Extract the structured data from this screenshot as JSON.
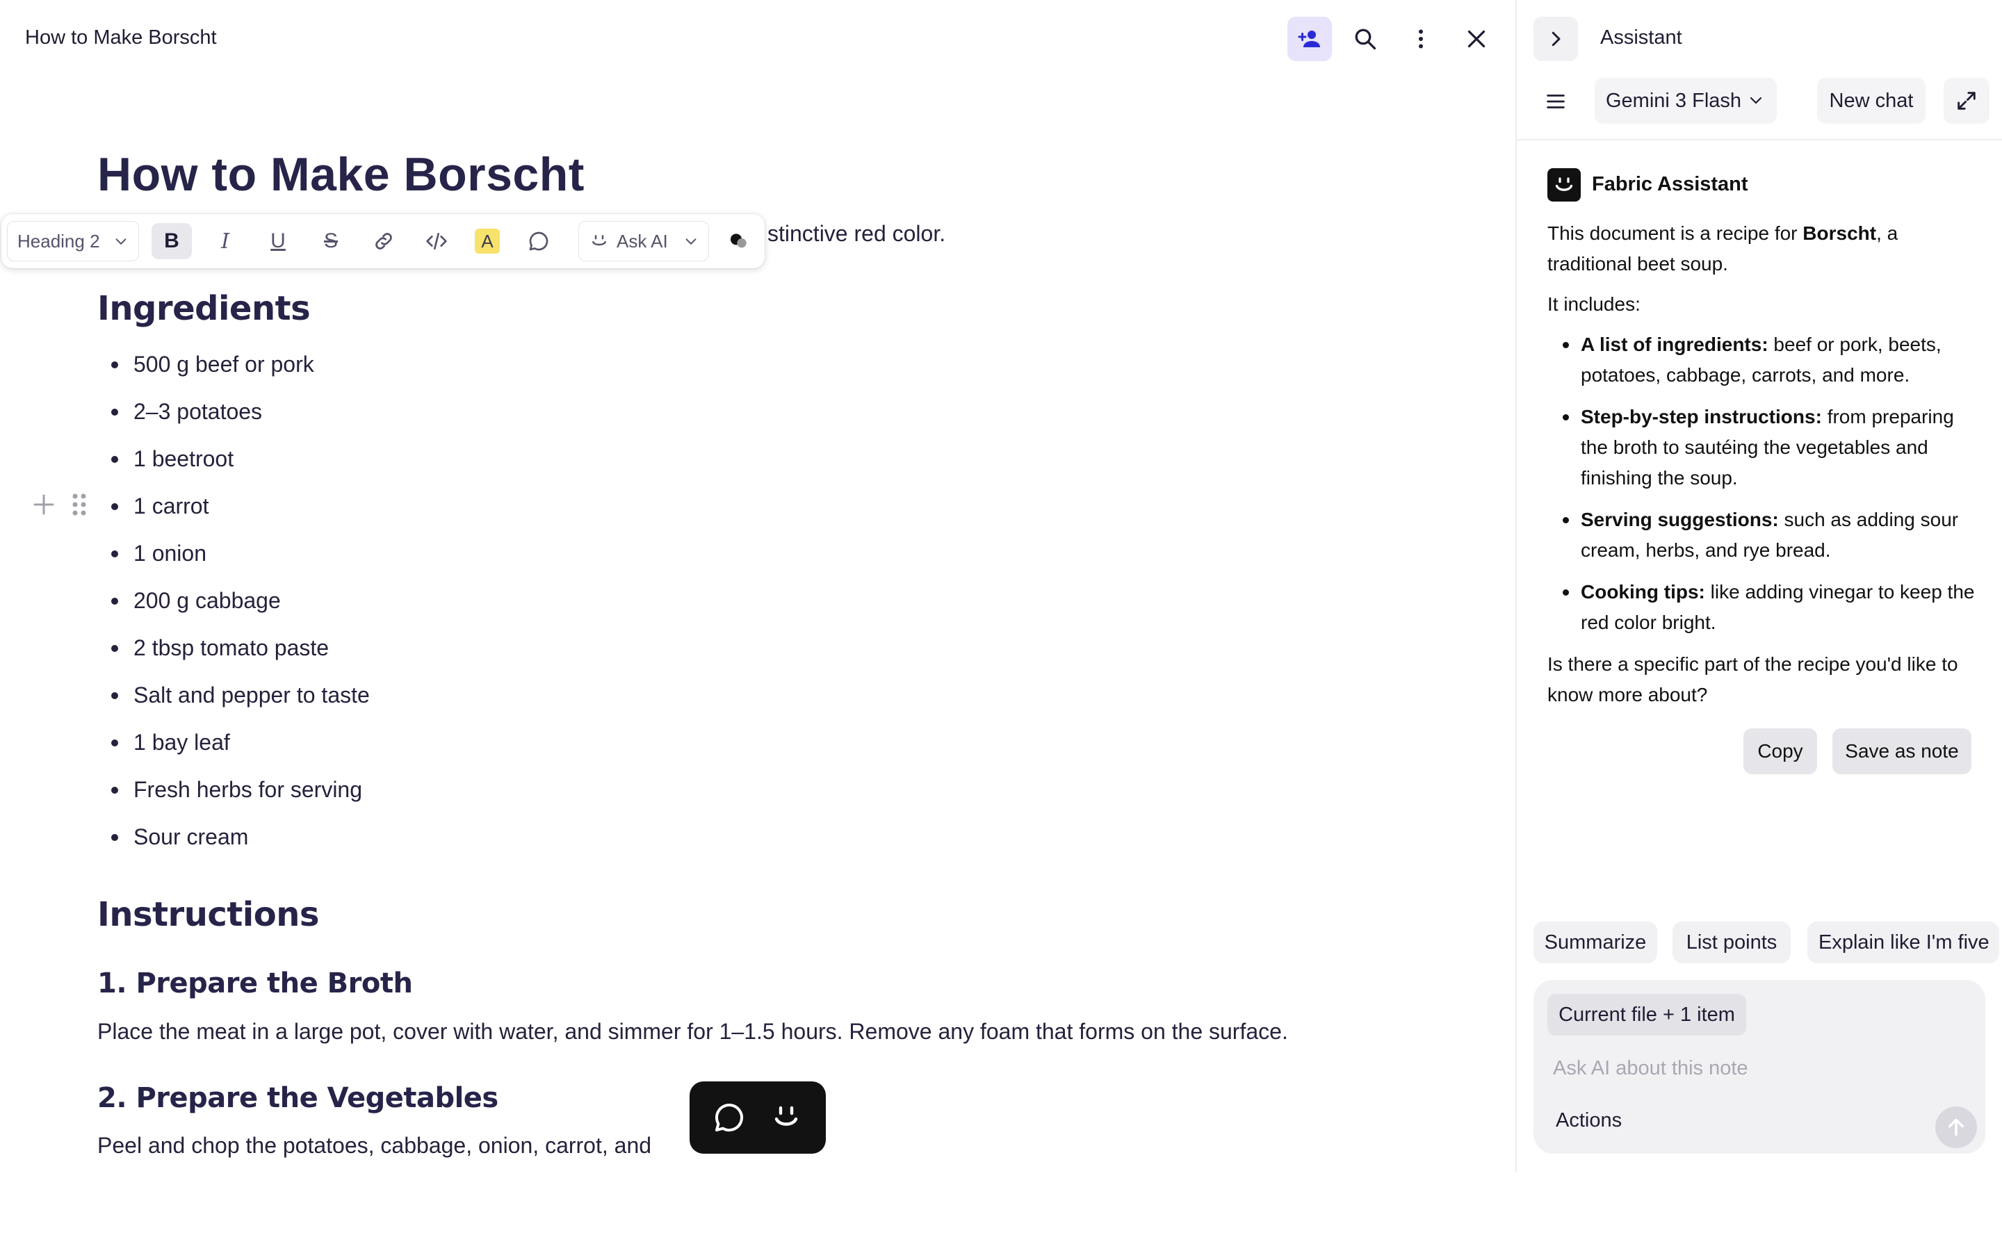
{
  "doc": {
    "topbar_title": "How to Make Borscht",
    "title": "How to Make Borscht",
    "intro_visible_tail": "stinctive red color.",
    "toolbar": {
      "block_type": "Heading 2",
      "bold": "B",
      "italic": "I",
      "underline": "U",
      "strike": "S",
      "highlight": "A",
      "ask_ai": "Ask AI"
    },
    "ingredients_heading": "Ingredients",
    "ingredients": [
      "500 g beef or pork",
      "2–3 potatoes",
      "1 beetroot",
      "1 carrot",
      "1 onion",
      "200 g cabbage",
      "2 tbsp tomato paste",
      "Salt and pepper to taste",
      "1 bay leaf",
      "Fresh herbs for serving",
      "Sour cream"
    ],
    "instructions_heading": "Instructions",
    "step1_heading": "1. Prepare the Broth",
    "step1_text": "Place the meat in a large pot, cover with water, and simmer for 1–1.5 hours. Remove any foam that forms on the surface.",
    "step2_heading": "2. Prepare the Vegetables",
    "step2_text": "Peel and chop the potatoes, cabbage, onion, carrot, and"
  },
  "assistant": {
    "title": "Assistant",
    "model": "Gemini 3 Flash",
    "new_chat": "New chat",
    "bot_name": "Fabric Assistant",
    "answer": {
      "intro_before": "This document is a recipe for ",
      "intro_bold": "Borscht",
      "intro_after": ", a traditional beet soup.",
      "includes": "It includes:",
      "items": [
        {
          "bold": "A list of ingredients:",
          "text": " beef or pork, beets, potatoes, cabbage, carrots, and more."
        },
        {
          "bold": "Step-by-step instructions:",
          "text": " from preparing the broth to sautéing the vegetables and finishing the soup."
        },
        {
          "bold": "Serving suggestions:",
          "text": " such as adding sour cream, herbs, and rye bread."
        },
        {
          "bold": "Cooking tips:",
          "text": " like adding vinegar to keep the red color bright."
        }
      ],
      "question": "Is there a specific part of the recipe you'd like to know more about?"
    },
    "copy": "Copy",
    "save_as_note": "Save as note",
    "suggestions": [
      "Summarize",
      "List points",
      "Explain like I'm five"
    ],
    "context_chip": "Current file + 1 item",
    "input_placeholder": "Ask AI about this note",
    "actions": "Actions"
  },
  "colors": {
    "accent": "#e6e3fb",
    "heading": "#27244a",
    "highlight": "#f7e36b"
  }
}
